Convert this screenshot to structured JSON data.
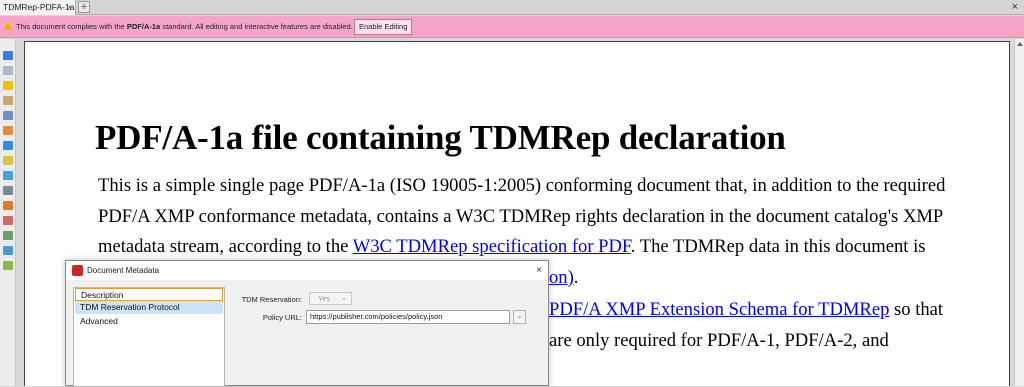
{
  "tabs": [
    {
      "label": "TDMRep-PDFA-1a",
      "close": "×"
    }
  ],
  "newtab": "+",
  "window_close": "×",
  "pdfa_bar": {
    "message_before": "This document complies with the ",
    "message_bold": "PDF/A-1a",
    "message_after": " standard. All editing and interactive features are disabled.",
    "button": "Enable Editing"
  },
  "document": {
    "title": "PDF/A-1a file containing TDMRep declaration",
    "lines": [
      "This is a simple single page PDF/A-1a (ISO 19005-1:2005) conforming document that, in addition to the required",
      "PDF/A XMP conformance metadata, contains a W3C TDMRep rights declaration in the document catalog's XMP"
    ],
    "line3_before": "metadata stream, according to the ",
    "line3_link": "W3C TDMRep specification for PDF",
    "line3_after": ". The TDMRep data in this document is",
    "line4_link": "on)",
    "line4_after": ".",
    "line5_link": "PDF/A XMP Extension Schema for TDMRep",
    "line5_after": " so that",
    "line6": "are only required for PDF/A-1, PDF/A-2, and"
  },
  "dialog": {
    "title": "Document Metadata",
    "close": "×",
    "categories": [
      "Description",
      "TDM Reservation Protocol",
      "Advanced"
    ],
    "selected_category": "TDM Reservation Protocol",
    "tdm_reservation_label": "TDM Reservation:",
    "tdm_reservation_value": "Yes",
    "policy_url_label": "Policy URL:",
    "policy_url_value": "https://publisher.com/policies/policy.json"
  },
  "colors": {
    "pdfa_bar": "#f5a6c8",
    "link": "#0000ee",
    "selection": "#cce4f7"
  },
  "icons": [
    "warning-icon",
    "dialog-app-icon",
    "chevron-down-icon",
    "close-icon",
    "scroll-up-icon"
  ]
}
